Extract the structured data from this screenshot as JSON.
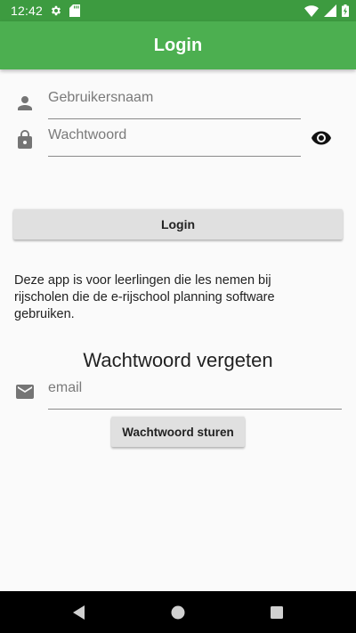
{
  "status_bar": {
    "time": "12:42",
    "icons": [
      "gear-icon",
      "sd-card-icon",
      "wifi-icon",
      "signal-icon",
      "battery-charging-icon"
    ]
  },
  "app_bar": {
    "title": "Login"
  },
  "login_form": {
    "username_placeholder": "Gebruikersnaam",
    "username_value": "",
    "password_placeholder": "Wachtwoord",
    "password_value": "",
    "login_button_label": "Login"
  },
  "info_text": "Deze app is voor leerlingen die les nemen bij rijscholen die de e-rijschool planning software gebruiken.",
  "forgot_password": {
    "heading": "Wachtwoord vergeten",
    "email_placeholder": "email",
    "email_value": "",
    "send_button_label": "Wachtwoord sturen"
  },
  "colors": {
    "status_bar": "#3d9b40",
    "app_bar": "#4caf50",
    "background": "#fafafa",
    "button": "#e0e0e0"
  }
}
